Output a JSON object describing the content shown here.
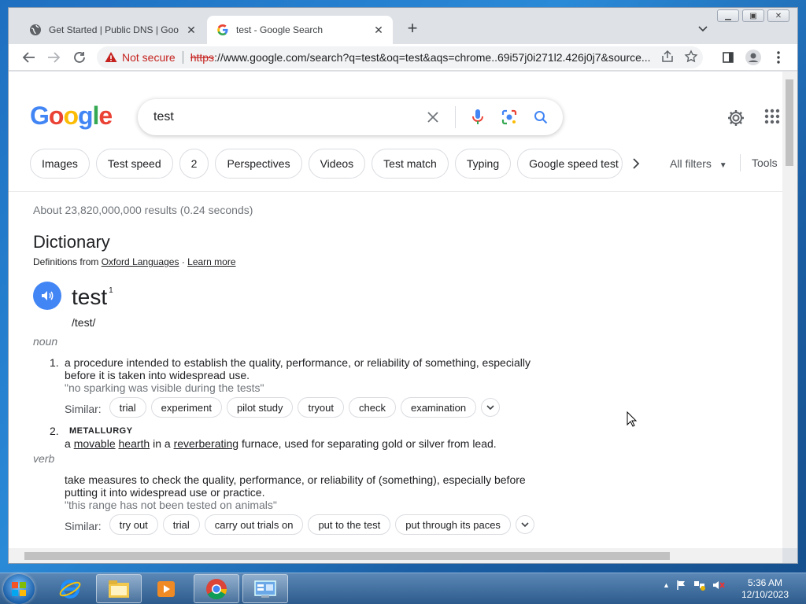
{
  "window": {
    "tabs": [
      {
        "title": "Get Started  |  Public DNS  |  Goo",
        "active": false
      },
      {
        "title": "test - Google Search",
        "active": true
      }
    ],
    "new_tab": "+"
  },
  "toolbar": {
    "security_label": "Not secure",
    "url_scheme": "https",
    "url_rest": "://www.google.com/search?q=test&oq=test&aqs=chrome..69i57j0i271l2.426j0j7&source..."
  },
  "search": {
    "logo_letters": [
      "G",
      "o",
      "o",
      "g",
      "l",
      "e"
    ],
    "query": "test",
    "chips": [
      "Images",
      "Test speed",
      "2",
      "Perspectives",
      "Videos",
      "Test match",
      "Typing",
      "Google speed test"
    ],
    "all_filters": "All filters",
    "tools": "Tools"
  },
  "results": {
    "stats": "About 23,820,000,000 results (0.24 seconds)"
  },
  "dictionary": {
    "title": "Dictionary",
    "source_prefix": "Definitions from",
    "source_link": "Oxford Languages",
    "separator": "·",
    "learn_more": "Learn more",
    "word": "test",
    "superscript": "1",
    "phonetic": "/test/",
    "noun_label": "noun",
    "verb_label": "verb",
    "similar_label": "Similar:",
    "def1_num": "1.",
    "def1_text": "a procedure intended to establish the quality, performance, or reliability of something, especially before it is taken into widespread use.",
    "def1_example": "\"no sparking was visible during the tests\"",
    "def1_synonyms": [
      "trial",
      "experiment",
      "pilot study",
      "tryout",
      "check",
      "examination"
    ],
    "def2_num": "2.",
    "def2_tag": "METALLURGY",
    "def2_parts": [
      "a ",
      "movable",
      " ",
      "hearth",
      " in a ",
      "reverberating",
      " furnace, used for separating gold or silver from lead."
    ],
    "verb_def_text": "take measures to check the quality, performance, or reliability of (something), especially before putting it into widespread use or practice.",
    "verb_def_example": "\"this range has not been tested on animals\"",
    "verb_synonyms": [
      "try out",
      "trial",
      "carry out trials on",
      "put to the test",
      "put through its paces"
    ]
  },
  "taskbar": {
    "time": "5:36 AM",
    "date": "12/10/2023"
  },
  "colors": {
    "google_blue": "#4285f4",
    "not_secure_red": "#c5221f"
  }
}
